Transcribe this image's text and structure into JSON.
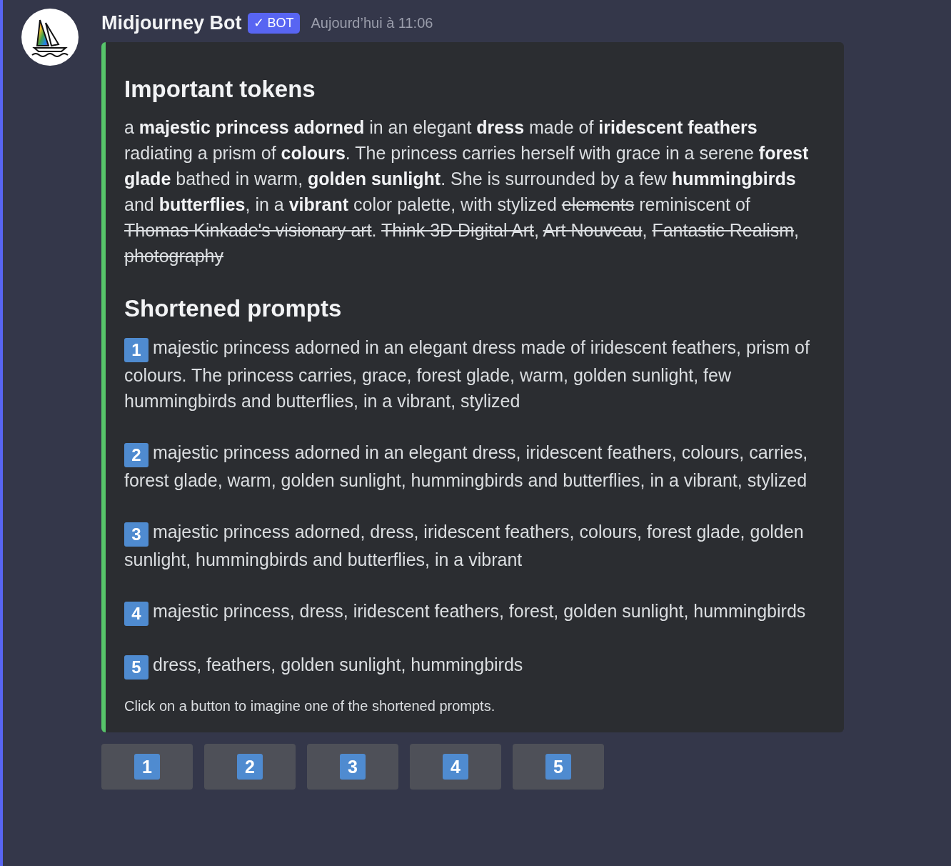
{
  "message": {
    "author": "Midjourney Bot",
    "badge": {
      "icon": "✓",
      "label": "BOT"
    },
    "timestamp": "Aujourd’hui à 11:06"
  },
  "embed": {
    "sections": [
      {
        "kind": "tokens",
        "heading": "Important tokens",
        "segments": [
          {
            "kind": "plain",
            "text": "a "
          },
          {
            "kind": "bold",
            "text": "majestic princess adorned"
          },
          {
            "kind": "plain",
            "text": " in an elegant "
          },
          {
            "kind": "bold",
            "text": "dress"
          },
          {
            "kind": "plain",
            "text": " made of "
          },
          {
            "kind": "bold",
            "text": "iridescent feathers"
          },
          {
            "kind": "plain",
            "text": " radiating a prism of "
          },
          {
            "kind": "bold",
            "text": "colours"
          },
          {
            "kind": "plain",
            "text": ". The princess carries herself with grace in a serene "
          },
          {
            "kind": "bold",
            "text": "forest glade"
          },
          {
            "kind": "plain",
            "text": " bathed in warm, "
          },
          {
            "kind": "bold",
            "text": "golden sunlight"
          },
          {
            "kind": "plain",
            "text": ". She is surrounded by a few "
          },
          {
            "kind": "bold",
            "text": "hummingbirds"
          },
          {
            "kind": "plain",
            "text": " and "
          },
          {
            "kind": "bold",
            "text": "butterflies"
          },
          {
            "kind": "plain",
            "text": ", in a "
          },
          {
            "kind": "bold",
            "text": "vibrant"
          },
          {
            "kind": "plain",
            "text": " color palette, with stylized "
          },
          {
            "kind": "strike",
            "text": "elements"
          },
          {
            "kind": "plain",
            "text": " reminiscent of "
          },
          {
            "kind": "strike",
            "text": "Thomas Kinkade's visionary art"
          },
          {
            "kind": "plain",
            "text": ". "
          },
          {
            "kind": "strike",
            "text": "Think 3D Digital Art"
          },
          {
            "kind": "plain",
            "text": ", "
          },
          {
            "kind": "strike",
            "text": "Art Nouveau"
          },
          {
            "kind": "plain",
            "text": ", "
          },
          {
            "kind": "strike",
            "text": "Fantastic Realism"
          },
          {
            "kind": "plain",
            "text": ", "
          },
          {
            "kind": "strike",
            "text": "photography"
          }
        ]
      },
      {
        "kind": "prompts",
        "heading": "Shortened prompts",
        "prompts": [
          {
            "number": "1",
            "text": "majestic princess adorned in an elegant dress made of iridescent feathers, prism of colours. The princess carries, grace, forest glade, warm, golden sunlight, few hummingbirds and butterflies, in a vibrant, stylized"
          },
          {
            "number": "2",
            "text": "majestic princess adorned in an elegant dress, iridescent feathers, colours, carries, forest glade, warm, golden sunlight, hummingbirds and butterflies, in a vibrant, stylized"
          },
          {
            "number": "3",
            "text": "majestic princess adorned, dress, iridescent feathers, colours, forest glade, golden sunlight, hummingbirds and butterflies, in a vibrant"
          },
          {
            "number": "4",
            "text": "majestic princess, dress, iridescent feathers, forest, golden sunlight, hummingbirds"
          },
          {
            "number": "5",
            "text": "dress, feathers, golden sunlight, hummingbirds"
          }
        ]
      }
    ],
    "footer": "Click on a button to imagine one of the shortened prompts."
  },
  "buttons": [
    {
      "label": "1"
    },
    {
      "label": "2"
    },
    {
      "label": "3"
    },
    {
      "label": "4"
    },
    {
      "label": "5"
    }
  ]
}
